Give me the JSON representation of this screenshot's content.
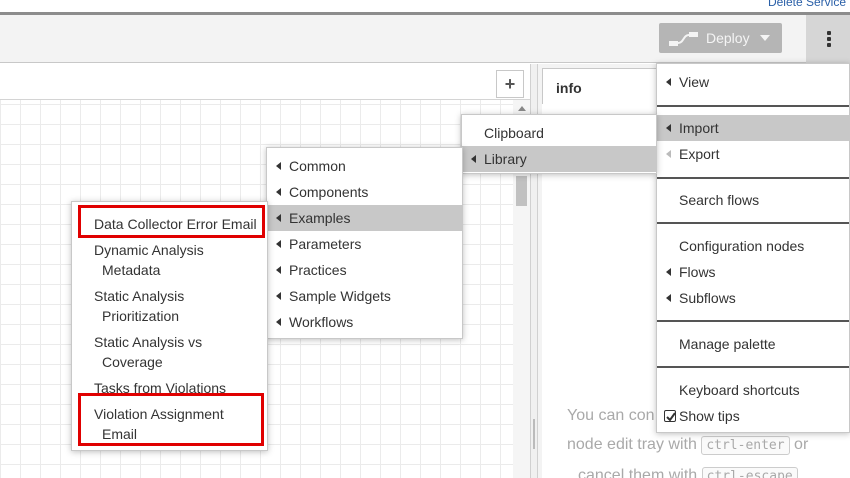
{
  "top_link": "Delete Service",
  "header": {
    "deploy_label": "Deploy",
    "menu_icon": "vertical-dots-icon"
  },
  "workspace": {
    "add_tab_label": "+"
  },
  "sidebar": {
    "info_tab_label": "info",
    "tips": {
      "line1": "You can con",
      "line2_pre": "node edit tray with",
      "key1": "ctrl-enter",
      "line2_post": "or",
      "line3_pre": "cancel them with",
      "key2": "ctrl-escape"
    }
  },
  "main_menu": {
    "view": "View",
    "import": "Import",
    "export": "Export",
    "search_flows": "Search flows",
    "configuration_nodes": "Configuration nodes",
    "flows": "Flows",
    "subflows": "Subflows",
    "manage_palette": "Manage palette",
    "keyboard_shortcuts": "Keyboard shortcuts",
    "show_tips": "Show tips"
  },
  "import_menu": {
    "clipboard": "Clipboard",
    "library": "Library"
  },
  "library_menu": {
    "items": [
      "Common",
      "Components",
      "Examples",
      "Parameters",
      "Practices",
      "Sample Widgets",
      "Workflows"
    ]
  },
  "examples_menu": {
    "item1": "Data Collector Error Email",
    "item2_l1": "Dynamic Analysis",
    "item2_l2": "Metadata",
    "item3_l1": "Static Analysis",
    "item3_l2": "Prioritization",
    "item4_l1": "Static Analysis vs",
    "item4_l2": "Coverage",
    "item5": "Tasks from Violations",
    "item6_l1": "Violation Assignment",
    "item6_l2": "Email"
  },
  "colors": {
    "highlight": "#c8c8c8",
    "annotation_red": "#e00000",
    "deploy_disabled": "#b5b5b5"
  }
}
